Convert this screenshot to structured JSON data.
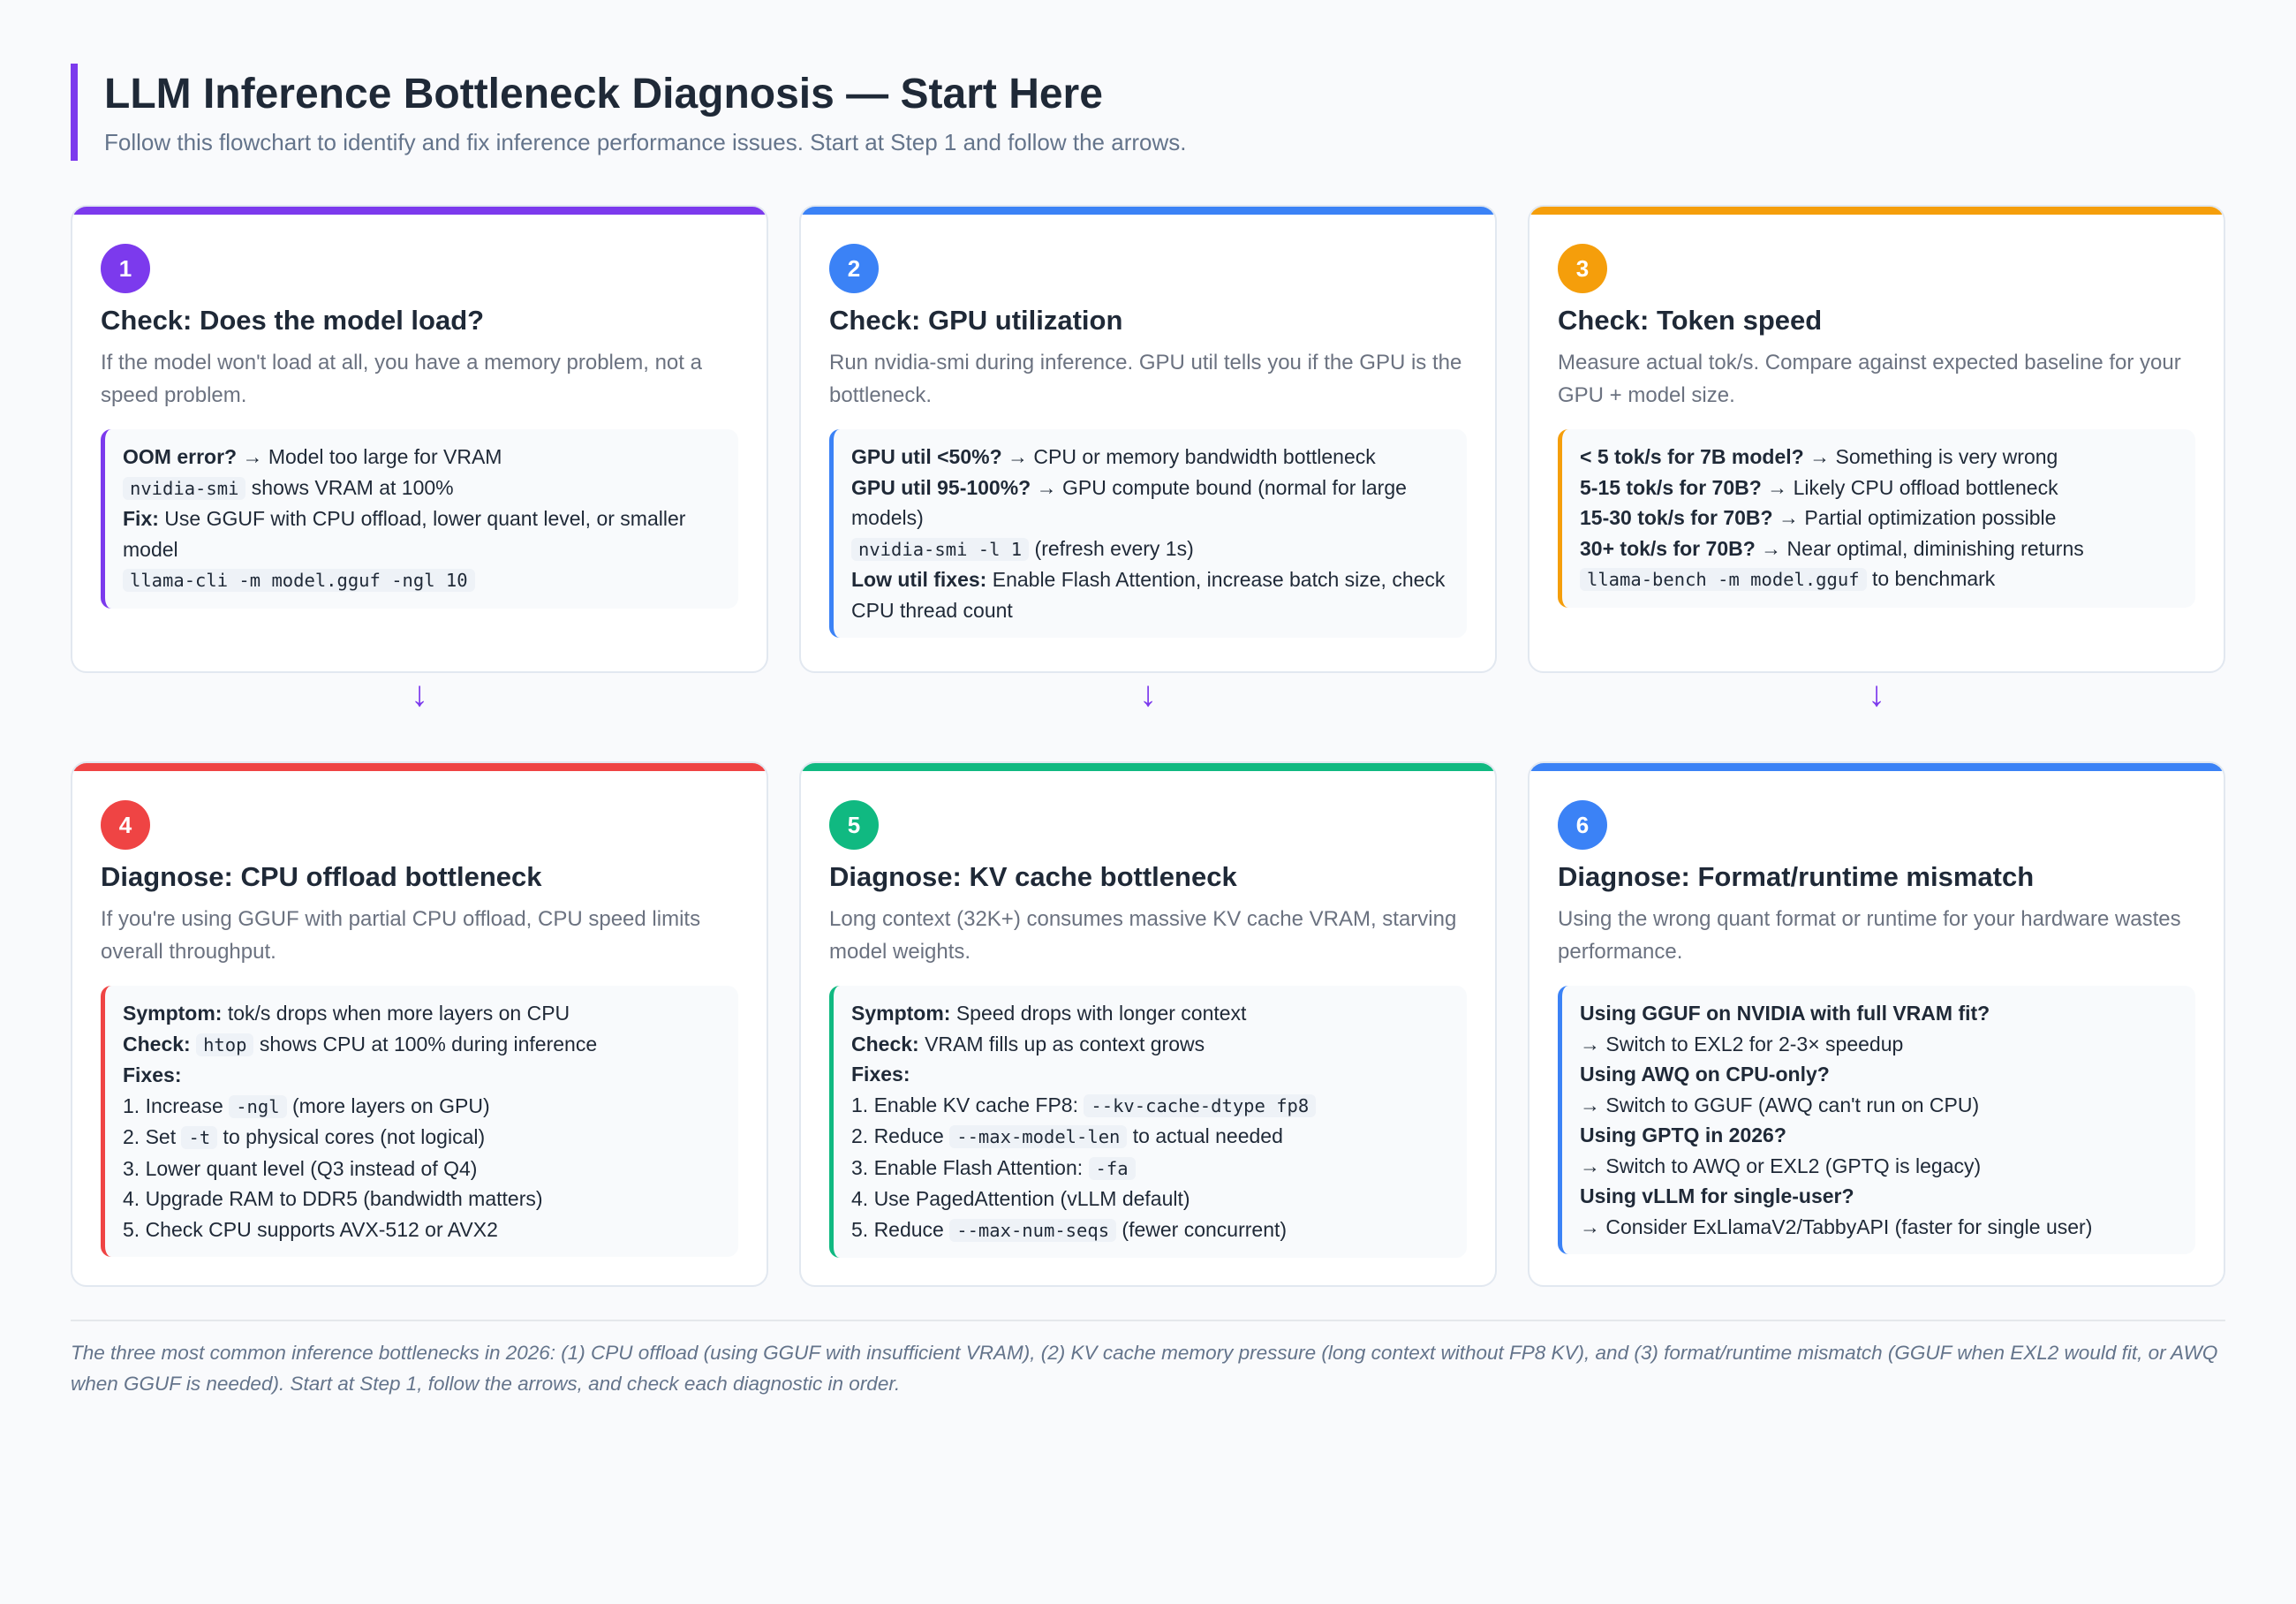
{
  "header": {
    "title": "LLM Inference Bottleneck Diagnosis — Start Here",
    "subtitle": "Follow this flowchart to identify and fix inference performance issues. Start at Step 1 and follow the arrows."
  },
  "arrow_glyph": "↓",
  "cards": [
    {
      "number": "1",
      "accent": "#7c3aed",
      "title": "Check: Does the model load?",
      "description": "If the model won't load at all, you have a memory problem, not a speed problem.",
      "lines": [
        [
          {
            "t": "OOM error?",
            "b": true
          },
          {
            "t": " → Model too large for VRAM"
          }
        ],
        [
          {
            "t": "nvidia-smi",
            "c": true
          },
          {
            "t": " shows VRAM at 100%"
          }
        ],
        [
          {
            "t": "Fix:",
            "b": true
          },
          {
            "t": " Use GGUF with CPU offload, lower quant level, or smaller model"
          }
        ],
        [
          {
            "t": "llama-cli -m model.gguf -ngl 10",
            "c": true
          }
        ]
      ]
    },
    {
      "number": "2",
      "accent": "#3b82f6",
      "title": "Check: GPU utilization",
      "description": "Run nvidia-smi during inference. GPU util tells you if the GPU is the bottleneck.",
      "lines": [
        [
          {
            "t": "GPU util <50%?",
            "b": true
          },
          {
            "t": " → CPU or memory bandwidth bottleneck"
          }
        ],
        [
          {
            "t": "GPU util 95-100%?",
            "b": true
          },
          {
            "t": " → GPU compute bound (normal for large models)"
          }
        ],
        [
          {
            "t": "nvidia-smi -l 1",
            "c": true
          },
          {
            "t": " (refresh every 1s)"
          }
        ],
        [
          {
            "t": "Low util fixes:",
            "b": true
          },
          {
            "t": " Enable Flash Attention, increase batch size, check CPU thread count"
          }
        ]
      ]
    },
    {
      "number": "3",
      "accent": "#f59e0b",
      "title": "Check: Token speed",
      "description": "Measure actual tok/s. Compare against expected baseline for your GPU + model size.",
      "lines": [
        [
          {
            "t": "< 5 tok/s for 7B model?",
            "b": true
          },
          {
            "t": " → Something is very wrong"
          }
        ],
        [
          {
            "t": "5-15 tok/s for 70B?",
            "b": true
          },
          {
            "t": " → Likely CPU offload bottleneck"
          }
        ],
        [
          {
            "t": "15-30 tok/s for 70B?",
            "b": true
          },
          {
            "t": " → Partial optimization possible"
          }
        ],
        [
          {
            "t": "30+ tok/s for 70B?",
            "b": true
          },
          {
            "t": " → Near optimal, diminishing returns"
          }
        ],
        [
          {
            "t": "llama-bench -m model.gguf",
            "c": true
          },
          {
            "t": " to benchmark"
          }
        ]
      ]
    },
    {
      "number": "4",
      "accent": "#ef4444",
      "title": "Diagnose: CPU offload bottleneck",
      "description": "If you're using GGUF with partial CPU offload, CPU speed limits overall throughput.",
      "lines": [
        [
          {
            "t": "Symptom:",
            "b": true
          },
          {
            "t": " tok/s drops when more layers on CPU"
          }
        ],
        [
          {
            "t": "Check:",
            "b": true
          },
          {
            "t": " "
          },
          {
            "t": "htop",
            "c": true
          },
          {
            "t": " shows CPU at 100% during inference"
          }
        ],
        [
          {
            "t": "Fixes:",
            "b": true
          }
        ],
        [
          {
            "t": "1. Increase "
          },
          {
            "t": "-ngl",
            "c": true
          },
          {
            "t": " (more layers on GPU)"
          }
        ],
        [
          {
            "t": "2. Set "
          },
          {
            "t": "-t",
            "c": true
          },
          {
            "t": " to physical cores (not logical)"
          }
        ],
        [
          {
            "t": "3. Lower quant level (Q3 instead of Q4)"
          }
        ],
        [
          {
            "t": "4. Upgrade RAM to DDR5 (bandwidth matters)"
          }
        ],
        [
          {
            "t": "5. Check CPU supports AVX-512 or AVX2"
          }
        ]
      ]
    },
    {
      "number": "5",
      "accent": "#10b981",
      "title": "Diagnose: KV cache bottleneck",
      "description": "Long context (32K+) consumes massive KV cache VRAM, starving model weights.",
      "lines": [
        [
          {
            "t": "Symptom:",
            "b": true
          },
          {
            "t": " Speed drops with longer context"
          }
        ],
        [
          {
            "t": "Check:",
            "b": true
          },
          {
            "t": " VRAM fills up as context grows"
          }
        ],
        [
          {
            "t": "Fixes:",
            "b": true
          }
        ],
        [
          {
            "t": "1. Enable KV cache FP8: "
          },
          {
            "t": "--kv-cache-dtype fp8",
            "c": true
          }
        ],
        [
          {
            "t": "2. Reduce "
          },
          {
            "t": "--max-model-len",
            "c": true
          },
          {
            "t": " to actual needed"
          }
        ],
        [
          {
            "t": "3. Enable Flash Attention: "
          },
          {
            "t": "-fa",
            "c": true
          }
        ],
        [
          {
            "t": "4. Use PagedAttention (vLLM default)"
          }
        ],
        [
          {
            "t": "5. Reduce "
          },
          {
            "t": "--max-num-seqs",
            "c": true
          },
          {
            "t": " (fewer concurrent)"
          }
        ]
      ]
    },
    {
      "number": "6",
      "accent": "#3b82f6",
      "title": "Diagnose: Format/runtime mismatch",
      "description": "Using the wrong quant format or runtime for your hardware wastes performance.",
      "lines": [
        [
          {
            "t": "Using GGUF on NVIDIA with full VRAM fit?",
            "b": true
          }
        ],
        [
          {
            "t": "→ Switch to EXL2 for 2-3× speedup"
          }
        ],
        [
          {
            "t": "Using AWQ on CPU-only?",
            "b": true
          }
        ],
        [
          {
            "t": "→ Switch to GGUF (AWQ can't run on CPU)"
          }
        ],
        [
          {
            "t": "Using GPTQ in 2026?",
            "b": true
          }
        ],
        [
          {
            "t": "→ Switch to AWQ or EXL2 (GPTQ is legacy)"
          }
        ],
        [
          {
            "t": "Using vLLM for single-user?",
            "b": true
          }
        ],
        [
          {
            "t": "→ Consider ExLlamaV2/TabbyAPI (faster for single user)"
          }
        ]
      ]
    }
  ],
  "footer": "The three most common inference bottlenecks in 2026: (1) CPU offload (using GGUF with insufficient VRAM), (2) KV cache memory pressure (long context without FP8 KV), and (3) format/runtime mismatch (GGUF when EXL2 would fit, or AWQ when GGUF is needed). Start at Step 1, follow the arrows, and check each diagnostic in order."
}
